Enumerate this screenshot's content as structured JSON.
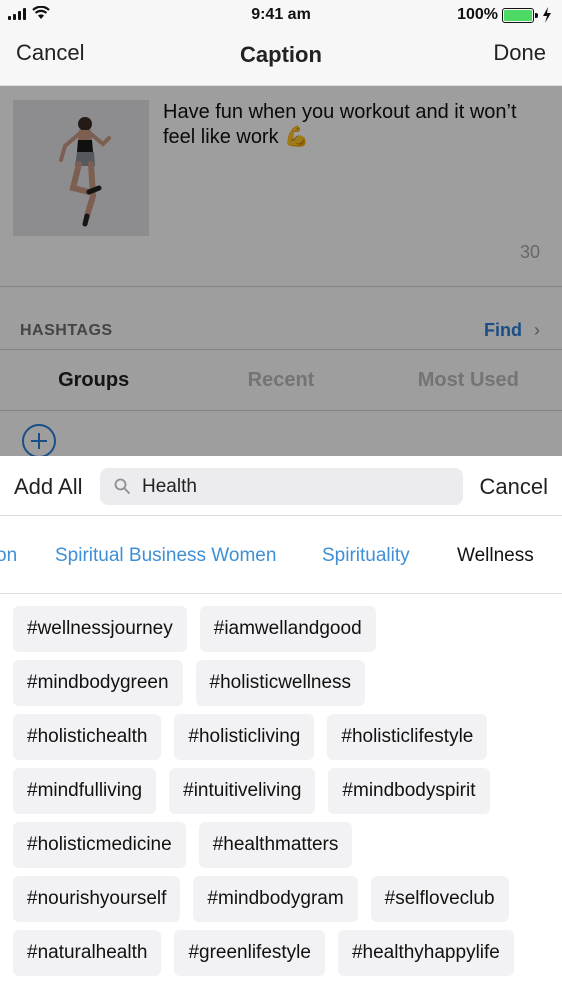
{
  "status_bar": {
    "time": "9:41 am",
    "battery": "100%"
  },
  "nav": {
    "cancel_label": "Cancel",
    "title": "Caption",
    "done_label": "Done"
  },
  "caption": {
    "text": "Have fun when you workout and it won’t feel like work 💪",
    "char_count": "30"
  },
  "hashtags": {
    "section_label": "HASHTAGS",
    "find_label": "Find",
    "tabs": [
      {
        "label": "Groups",
        "active": true
      },
      {
        "label": "Recent",
        "active": false
      },
      {
        "label": "Most Used",
        "active": false
      }
    ]
  },
  "search_sheet": {
    "add_all_label": "Add All",
    "search_value": "Health",
    "cancel_label": "Cancel",
    "groups": [
      {
        "label": "on",
        "active": false
      },
      {
        "label": "Spiritual Business Women",
        "active": false
      },
      {
        "label": "Spirituality",
        "active": false
      },
      {
        "label": "Wellness",
        "active": true
      }
    ],
    "tag_rows": [
      [
        "#wellnessjourney",
        "#iamwellandgood"
      ],
      [
        "#mindbodygreen",
        "#holisticwellness"
      ],
      [
        "#holistichealth",
        "#holisticliving",
        "#holisticlifestyle"
      ],
      [
        "#mindfulliving",
        "#intuitiveliving",
        "#mindbodyspirit"
      ],
      [
        "#holisticmedicine",
        "#healthmatters"
      ],
      [
        "#nourishyourself",
        "#mindbodygram",
        "#selfloveclub"
      ],
      [
        "#naturalhealth",
        "#greenlifestyle",
        "#healthyhappylife"
      ]
    ]
  },
  "colors": {
    "accent_blue": "#2a7fd9",
    "group_link_blue": "#3e8fd6",
    "battery_green": "#4cd964"
  }
}
